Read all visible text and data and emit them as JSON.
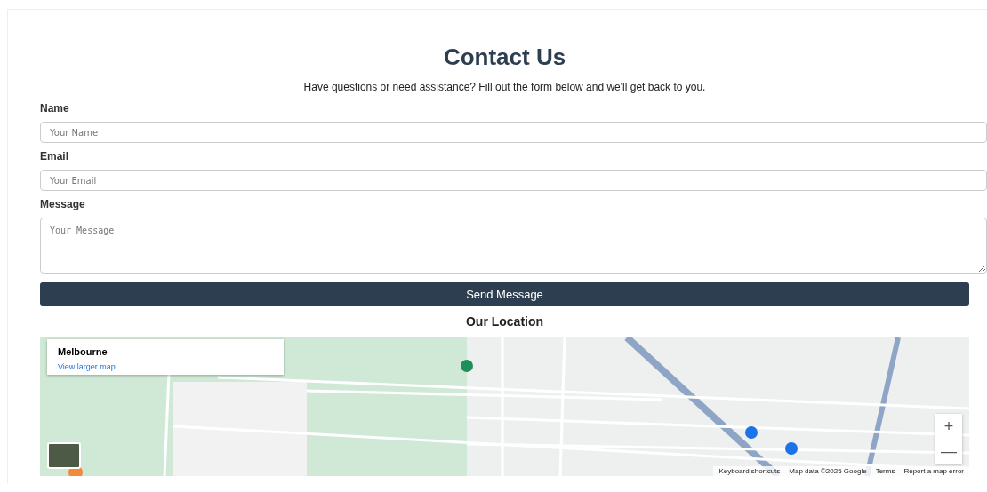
{
  "title": "Contact Us",
  "subtitle": "Have questions or need assistance? Fill out the form below and we'll get back to you.",
  "fields": [
    {
      "label": "Name",
      "placeholder": "Your Name",
      "kind": "input"
    },
    {
      "label": "Email",
      "placeholder": "Your Email",
      "kind": "input"
    },
    {
      "label": "Message",
      "placeholder": "Your Message",
      "kind": "textarea"
    }
  ],
  "submit": "Send Message",
  "location_heading": "Our Location",
  "map": {
    "place": "Melbourne",
    "link": "View larger map",
    "zoom_in": "+",
    "zoom_out": "—",
    "footer": [
      "Keyboard shortcuts",
      "Map data ©2025 Google",
      "Terms",
      "Report a map error"
    ]
  }
}
